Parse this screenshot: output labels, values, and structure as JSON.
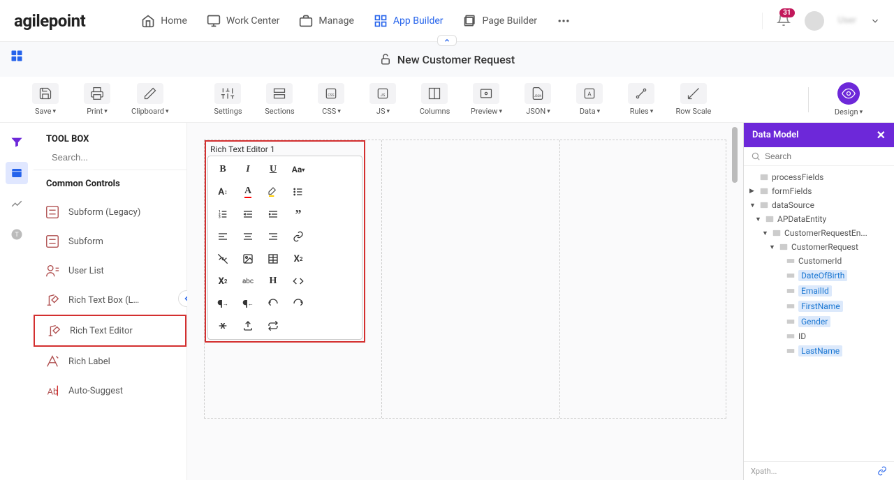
{
  "header": {
    "logo": "agilepoint",
    "nav": {
      "home": "Home",
      "work_center": "Work Center",
      "manage": "Manage",
      "app_builder": "App Builder",
      "page_builder": "Page Builder"
    },
    "notification_count": "31",
    "username": "User"
  },
  "page": {
    "title": "New Customer Request"
  },
  "toolbar": {
    "save": "Save",
    "print": "Print",
    "clipboard": "Clipboard",
    "settings": "Settings",
    "sections": "Sections",
    "css": "CSS",
    "js": "JS",
    "columns": "Columns",
    "preview": "Preview",
    "json": "JSON",
    "data": "Data",
    "rules": "Rules",
    "row_scale": "Row Scale",
    "design": "Design"
  },
  "toolbox": {
    "title": "TOOL BOX",
    "search_placeholder": "Search...",
    "section": "Common Controls",
    "items": {
      "subform_legacy": "Subform (Legacy)",
      "subform": "Subform",
      "user_list": "User List",
      "rich_text_box": "Rich Text Box (L…",
      "rich_text_editor": "Rich Text Editor",
      "rich_label": "Rich Label",
      "auto_suggest": "Auto-Suggest"
    }
  },
  "canvas": {
    "rte_label": "Rich Text Editor 1",
    "rte_buttons": {
      "bold": "B",
      "italic": "I",
      "underline": "U",
      "case": "Aa",
      "font_size": "A±",
      "clear": "abc",
      "heading": "H",
      "super": "x",
      "sub": "X"
    }
  },
  "data_model": {
    "title": "Data Model",
    "search_placeholder": "Search",
    "tree": {
      "process_fields": "processFields",
      "form_fields": "formFields",
      "data_source": "dataSource",
      "ap_data_entity": "APDataEntity",
      "customer_request_en": "CustomerRequestEn...",
      "customer_request": "CustomerRequest",
      "customer_id": "CustomerId",
      "date_of_birth": "DateOfBirth",
      "email_id": "EmailId",
      "first_name": "FirstName",
      "gender": "Gender",
      "id": "ID",
      "last_name": "LastName"
    },
    "xpath": "Xpath..."
  }
}
